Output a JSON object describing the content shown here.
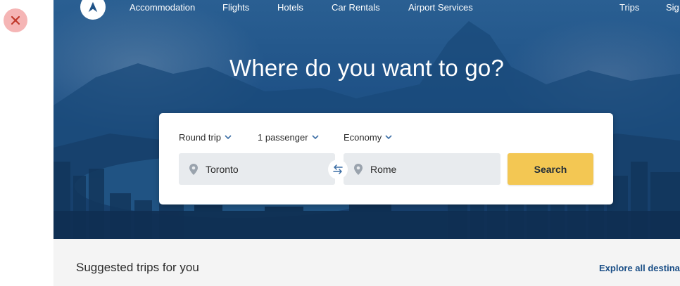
{
  "nav": {
    "links": [
      "Accommodation",
      "Flights",
      "Hotels",
      "Car Rentals",
      "Airport Services"
    ],
    "right_links": [
      "Trips",
      "Sig"
    ]
  },
  "hero": {
    "headline": "Where do you want to go?"
  },
  "search": {
    "trip_type": "Round trip",
    "passengers": "1 passenger",
    "cabin_class": "Economy",
    "origin": "Toronto",
    "destination": "Rome",
    "search_label": "Search"
  },
  "suggested": {
    "title": "Suggested trips for you",
    "explore_link": "Explore all destinati"
  },
  "icons": {
    "close": "close-icon",
    "logo": "logo-icon",
    "chevron": "chevron-down-icon",
    "pin": "location-pin-icon",
    "swap": "swap-arrows-icon"
  },
  "colors": {
    "hero_blue": "#1f5287",
    "search_button": "#f3c753",
    "close_button_bg": "#f5b5b5",
    "close_icon": "#c0392b",
    "link_blue": "#1a4e86",
    "field_bg": "#e8ebee"
  }
}
